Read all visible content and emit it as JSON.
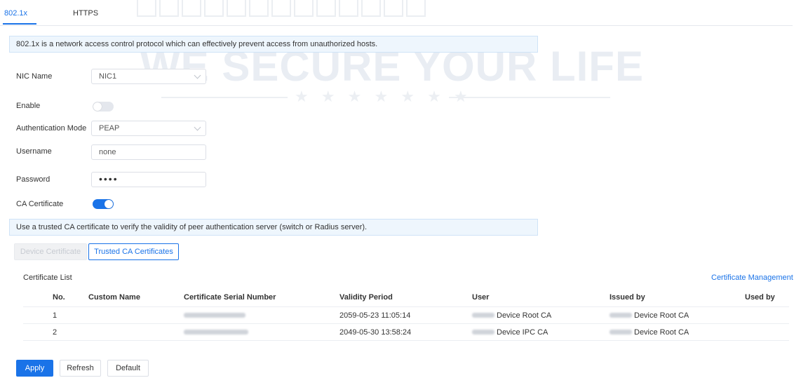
{
  "tabs": [
    {
      "label": "802.1x"
    },
    {
      "label": "HTTPS"
    }
  ],
  "watermark": {
    "text": "WE SECURE YOUR LIFE",
    "stars": "★ ★ ★ ★ ★ ★ ★"
  },
  "info_text": "802.1x is a network access control protocol which can effectively prevent access from unauthorized hosts.",
  "form": {
    "nic_name": {
      "label": "NIC Name",
      "value": "NIC1"
    },
    "enable": {
      "label": "Enable",
      "on": false
    },
    "auth_mode": {
      "label": "Authentication Mode",
      "value": "PEAP"
    },
    "username": {
      "label": "Username",
      "value": "none"
    },
    "password": {
      "label": "Password",
      "value": "••••"
    },
    "ca_certificate": {
      "label": "CA Certificate",
      "on": true
    }
  },
  "ca_info_text": "Use a trusted CA certificate to verify the validity of peer authentication server (switch or Radius server).",
  "cert_tabs": {
    "device": "Device Certificate",
    "trusted": "Trusted CA Certificates"
  },
  "certificate_list": {
    "title": "Certificate List",
    "management_link": "Certificate Management",
    "columns": [
      "No.",
      "Custom Name",
      "Certificate Serial Number",
      "Validity Period",
      "User",
      "Issued by",
      "Used by"
    ],
    "rows": [
      {
        "no": "1",
        "custom_name": "",
        "validity": "2059-05-23 11:05:14",
        "user": "Device Root CA",
        "issued_by": "Device Root CA",
        "used_by": ""
      },
      {
        "no": "2",
        "custom_name": "",
        "validity": "2049-05-30 13:58:24",
        "user": "Device IPC CA",
        "issued_by": "Device Root CA",
        "used_by": ""
      }
    ]
  },
  "buttons": {
    "apply": "Apply",
    "refresh": "Refresh",
    "default": "Default"
  },
  "colors": {
    "accent": "#1a73e8",
    "info_bg": "#eef6fd"
  }
}
